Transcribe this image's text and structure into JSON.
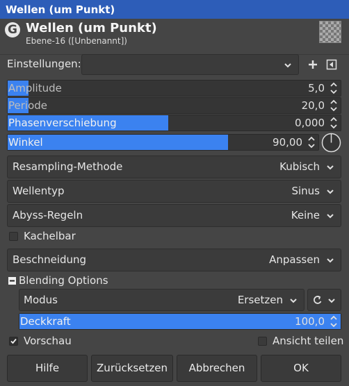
{
  "window": {
    "title": "Wellen (um Punkt)"
  },
  "header": {
    "title": "Wellen (um Punkt)",
    "subtitle": "Ebene-16 ([Unbenannt])"
  },
  "presets": {
    "label": "Einstellungen:",
    "value": ""
  },
  "sliders": {
    "amplitude": {
      "label": "Amplitude",
      "value": "5,0",
      "fill": 0.063
    },
    "periode": {
      "label": "Periode",
      "value": "20,0",
      "fill": 0.063
    },
    "phase": {
      "label": "Phasenverschiebung",
      "value": "0,000",
      "fill": 0.482
    },
    "winkel": {
      "label": "Winkel",
      "value": "90,00",
      "fill": 0.71
    }
  },
  "resampling": {
    "label": "Resampling-Methode",
    "value": "Kubisch"
  },
  "wellentyp": {
    "label": "Wellentyp",
    "value": "Sinus"
  },
  "abyss": {
    "label": "Abyss-Regeln",
    "value": "Keine"
  },
  "kachelbar": {
    "label": "Kachelbar",
    "checked": false
  },
  "beschneidung": {
    "label": "Beschneidung",
    "value": "Anpassen"
  },
  "blending": {
    "label": "Blending Options",
    "modus_label": "Modus",
    "modus_value": "Ersetzen",
    "deckkraft_label": "Deckkraft",
    "deckkraft_value": "100,0",
    "deckkraft_fill": 1.0
  },
  "vorschau": {
    "label": "Vorschau",
    "checked": true
  },
  "ansicht": {
    "label": "Ansicht teilen",
    "checked": false
  },
  "buttons": {
    "help": "Hilfe",
    "reset": "Zurücksetzen",
    "cancel": "Abbrechen",
    "ok": "OK"
  },
  "colors": {
    "accent": "#3b82f0",
    "titlebar": "#2d5db8",
    "background": "#454545"
  },
  "icons": [
    "gimp-logo-icon",
    "chevron-down-icon",
    "plus-icon",
    "menu-arrow-icon",
    "spin-arrows-icon",
    "angle-dial-icon",
    "collapse-icon",
    "reset-mode-icon",
    "checkmark-icon"
  ]
}
